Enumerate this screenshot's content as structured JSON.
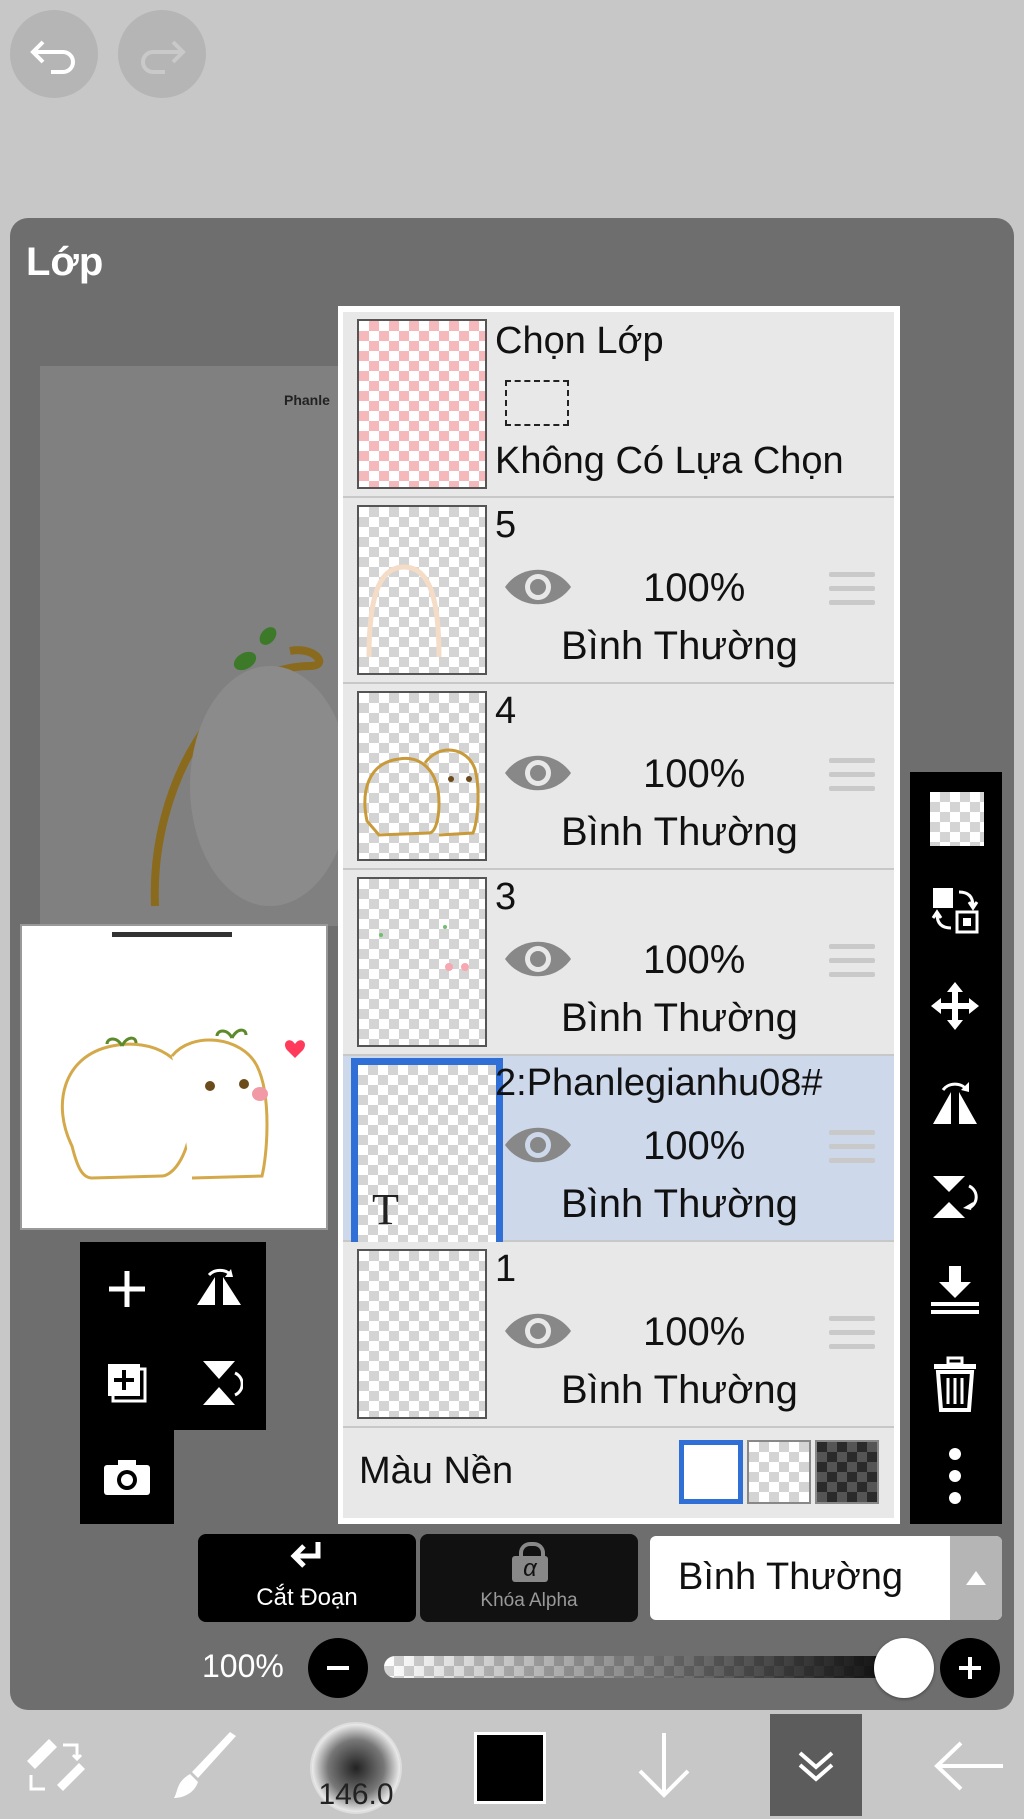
{
  "panel": {
    "title": "Lớp"
  },
  "canvas_preview": {
    "watermark": "Phanle"
  },
  "select_layer": {
    "title": "Chọn Lớp",
    "status": "Không Có Lựa Chọn"
  },
  "layers": [
    {
      "name": "5",
      "opacity": "100%",
      "blend": "Bình Thường",
      "visible": true,
      "selected": false
    },
    {
      "name": "4",
      "opacity": "100%",
      "blend": "Bình Thường",
      "visible": true,
      "selected": false
    },
    {
      "name": "3",
      "opacity": "100%",
      "blend": "Bình Thường",
      "visible": true,
      "selected": false
    },
    {
      "name": "2:Phanlegianhu08#",
      "opacity": "100%",
      "blend": "Bình Thường",
      "visible": true,
      "selected": true,
      "type": "text"
    },
    {
      "name": "1",
      "opacity": "100%",
      "blend": "Bình Thường",
      "visible": true,
      "selected": false
    }
  ],
  "background": {
    "label": "Màu Nền",
    "options": [
      "white",
      "transparent",
      "dark"
    ],
    "selected": "white"
  },
  "bottom_controls": {
    "clip_label": "Cắt Đoạn",
    "alpha_lock_label": "Khóa Alpha",
    "alpha_symbol": "α",
    "blend_mode": "Bình Thường"
  },
  "opacity_slider": {
    "label": "100%",
    "value": 1.0
  },
  "toolbar": {
    "brush_size": "146.0",
    "current_color": "#000000"
  },
  "colors": {
    "selection_blue": "#2f6fd6",
    "selected_row": "#cdd8ea"
  }
}
